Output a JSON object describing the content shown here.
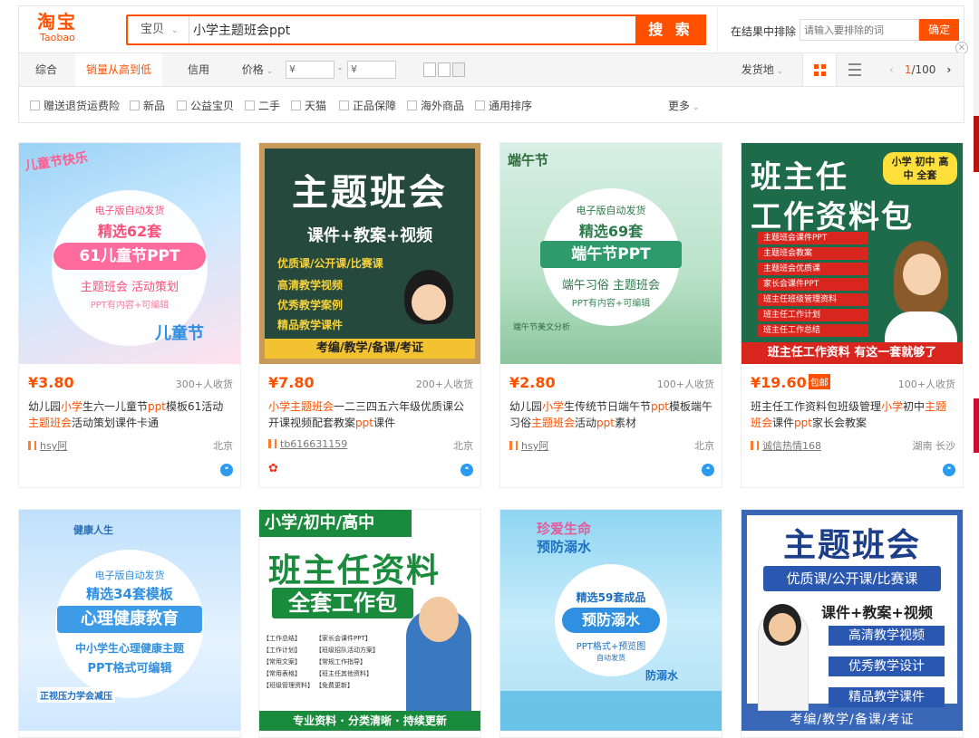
{
  "header": {
    "logo_cn": "淘宝",
    "logo_en": "Taobao",
    "scope": "宝贝",
    "query": "小学主题班会ppt",
    "search_btn": "搜 索",
    "exclude_label": "在结果中排除",
    "exclude_placeholder": "请输入要排除的词",
    "exclude_btn": "确定",
    "close": "×"
  },
  "sort": {
    "items": [
      "综合",
      "销量从高到低",
      "信用",
      "价格"
    ],
    "price_min": "¥",
    "price_sep": "-",
    "price_max": "¥",
    "ship_from": "发货地",
    "page_current": "1",
    "page_total": "/100"
  },
  "filters": {
    "items": [
      "赠送退货运费险",
      "新品",
      "公益宝贝",
      "二手",
      "天猫",
      "正品保障",
      "海外商品",
      "通用排序"
    ],
    "more": "更多"
  },
  "products": [
    {
      "price": "¥3.80",
      "badge": "",
      "sales": "300+人收货",
      "title_parts": [
        "幼儿园",
        "小学",
        "生六一儿童节",
        "ppt",
        "模板61活动",
        "主题班会",
        "活动策划课件卡通"
      ],
      "shop": "hsy阿",
      "loc": "北京",
      "img": {
        "l1": "儿童节快乐",
        "l2": "电子版自动发货",
        "l3": "精选62套",
        "l4": "61儿童节PPT",
        "l5": "主题班会 活动策划",
        "l6": "PPT有内容+可编辑",
        "l7": "儿童节"
      }
    },
    {
      "price": "¥7.80",
      "badge": "",
      "sales": "200+人收货",
      "title_parts": [
        "",
        "小学主题班会",
        "一二三四五六年级优质课公开课视频配套教案",
        "ppt",
        "课件"
      ],
      "shop": "tb616631159",
      "loc": "北京",
      "img": {
        "l1": "主题班会",
        "l2": "课件+教案+视频",
        "l3": "优质课/公开课/比赛课",
        "l4": "高清教学视频",
        "l5": "优秀教学案例",
        "l6": "精品教学课件",
        "l7": "考编/教学/备课/考证"
      }
    },
    {
      "price": "¥2.80",
      "badge": "",
      "sales": "100+人收货",
      "title_parts": [
        "幼儿园",
        "小学",
        "生传统节日端午节",
        "ppt",
        "模板端午习俗",
        "主题班会",
        "活动",
        "ppt",
        "素材"
      ],
      "shop": "hsy阿",
      "loc": "北京",
      "img": {
        "l1": "端午节",
        "l2": "电子版自动发货",
        "l3": "精选69套",
        "l4": "端午节PPT",
        "l5": "端午习俗 主题班会",
        "l6": "PPT有内容+可编辑",
        "l7": "端午节美文分析"
      }
    },
    {
      "price": "¥19.60",
      "badge": "包邮",
      "sales": "100+人收货",
      "title_parts": [
        "班主任工作资料包班级管理",
        "小学",
        "初中",
        "主题班会",
        "课件",
        "ppt",
        "家长会教案"
      ],
      "shop": "诚信热情168",
      "loc": "湖南 长沙",
      "img": {
        "l1": "班主任",
        "l2": "工作资料包",
        "l3": "小学 初中 高中 全套",
        "items": [
          "主题班会课件PPT",
          "主题班会教案",
          "主题班会优质课",
          "家长会课件PPT",
          "班主任班级管理资料",
          "班主任工作计划",
          "班主任工作总结"
        ],
        "l7": "班主任工作资料 有这一套就够了"
      }
    },
    {
      "img": {
        "l1": "精选34套模板",
        "l2": "电子版自动发货",
        "l3": "心理健康教育",
        "l4": "中小学生心理健康主题",
        "l5": "PPT格式可编辑",
        "l6": "正视压力学会减压",
        "l7": "健康人生"
      }
    },
    {
      "img": {
        "l1": "小学/初中/高中",
        "l2": "班主任资料",
        "l3": "全套工作包",
        "items": [
          "【工作总结】",
          "【工作计划】",
          "【常用文案】",
          "【常用表格】",
          "【班级管理资料】",
          "【家长会课件PPT】",
          "【班级招队活动方案】",
          "【常规工作指导】",
          "【班主任其他资料】",
          "【免费更新】"
        ],
        "l7": "专业资料 · 分类清晰 · 持续更新"
      }
    },
    {
      "img": {
        "l1": "珍爱生命",
        "l2": "预防溺水",
        "l3": "精选59套成品",
        "l4": "预防溺水",
        "l5": "PPT格式+预览图",
        "l6": "自动发货",
        "l7": "防溺水"
      }
    },
    {
      "img": {
        "l1": "主题班会",
        "l2": "优质课/公开课/比赛课",
        "l3": "课件+教案+视频",
        "items": [
          "高清教学视频",
          "优秀教学设计",
          "精品教学课件"
        ],
        "l7": "考编/教学/备课/考证"
      }
    }
  ]
}
